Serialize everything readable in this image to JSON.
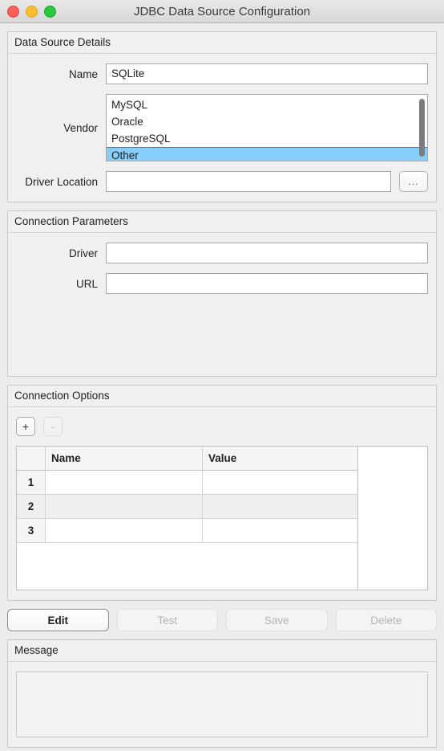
{
  "window": {
    "title": "JDBC Data Source Configuration",
    "traffic_lights": [
      {
        "name": "close",
        "color": "#ff5f57"
      },
      {
        "name": "minimize",
        "color": "#febc2e"
      },
      {
        "name": "zoom",
        "color": "#28c840"
      }
    ]
  },
  "data_source_details": {
    "title": "Data Source Details",
    "name": {
      "label": "Name",
      "value": "SQLite"
    },
    "vendor": {
      "label": "Vendor",
      "items": [
        "MySQL",
        "Oracle",
        "PostgreSQL",
        "Other"
      ],
      "selected": "Other",
      "scrolled": true
    },
    "driver_location": {
      "label": "Driver Location",
      "value": "",
      "browse_label": "..."
    }
  },
  "connection_parameters": {
    "title": "Connection Parameters",
    "driver": {
      "label": "Driver",
      "value": ""
    },
    "url": {
      "label": "URL",
      "value": ""
    }
  },
  "connection_options": {
    "title": "Connection Options",
    "add_label": "+",
    "remove_label": "-",
    "remove_enabled": false,
    "table": {
      "columns": [
        "",
        "Name",
        "Value"
      ],
      "rows": [
        {
          "index": "1",
          "name": "",
          "value": ""
        },
        {
          "index": "2",
          "name": "",
          "value": ""
        },
        {
          "index": "3",
          "name": "",
          "value": ""
        }
      ]
    }
  },
  "actions": [
    {
      "label": "Edit",
      "enabled": true
    },
    {
      "label": "Test",
      "enabled": false
    },
    {
      "label": "Save",
      "enabled": false
    },
    {
      "label": "Delete",
      "enabled": false
    }
  ],
  "message": {
    "title": "Message",
    "text": ""
  },
  "colors": {
    "selection": "#87cefa",
    "selection_border": "#2b83d4",
    "window_bg": "#ececec",
    "group_bg": "#f0f0f0"
  }
}
